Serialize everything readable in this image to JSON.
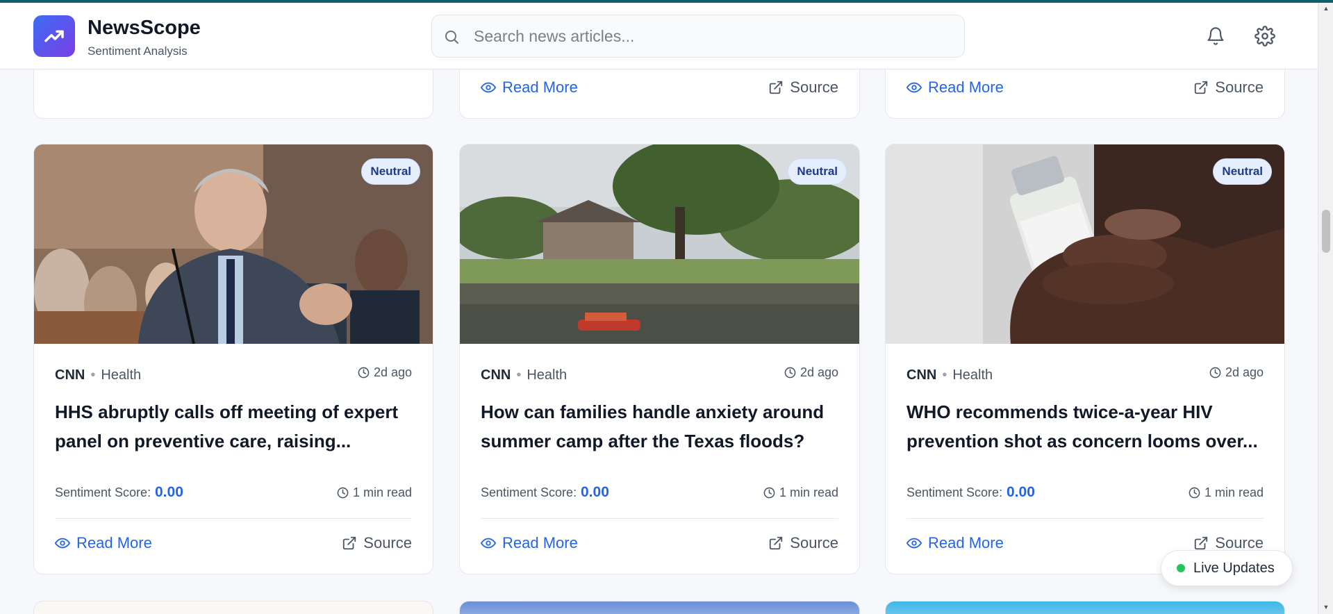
{
  "header": {
    "app_name": "NewsScope",
    "app_subtitle": "Sentiment Analysis",
    "search_placeholder": "Search news articles...",
    "notification_icon": "bell-icon",
    "settings_icon": "gear-icon",
    "logo_icon": "trending-up-icon"
  },
  "top_row": [
    {
      "read_more": "",
      "source": ""
    },
    {
      "read_more": "Read More",
      "source": "Source"
    },
    {
      "read_more": "Read More",
      "source": "Source"
    }
  ],
  "cards": [
    {
      "badge": "Neutral",
      "source": "CNN",
      "category": "Health",
      "time_ago": "2d ago",
      "title": "HHS abruptly calls off meeting of expert panel on preventive care, raising...",
      "score_label": "Sentiment Score:",
      "score": "0.00",
      "read_time": "1 min read",
      "read_more": "Read More",
      "source_link": "Source"
    },
    {
      "badge": "Neutral",
      "source": "CNN",
      "category": "Health",
      "time_ago": "2d ago",
      "title": "How can families handle anxiety around summer camp after the Texas floods?",
      "score_label": "Sentiment Score:",
      "score": "0.00",
      "read_time": "1 min read",
      "read_more": "Read More",
      "source_link": "Source"
    },
    {
      "badge": "Neutral",
      "source": "CNN",
      "category": "Health",
      "time_ago": "2d ago",
      "title": "WHO recommends twice-a-year HIV prevention shot as concern looms over...",
      "score_label": "Sentiment Score:",
      "score": "0.00",
      "read_time": "1 min read",
      "read_more": "Read More",
      "source_link": "Source"
    }
  ],
  "live_updates": {
    "label": "Live Updates",
    "status_color": "#22c55e"
  },
  "colors": {
    "accent": "#2563eb",
    "badge_bg": "#e5eefc",
    "badge_text": "#1e3a8a",
    "logo_gradient_start": "#3b6cf6",
    "logo_gradient_end": "#7b3fe4"
  }
}
